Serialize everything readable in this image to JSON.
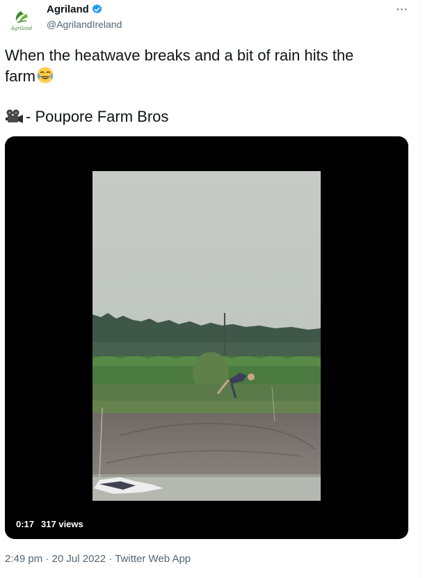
{
  "account": {
    "display_name": "Agriland",
    "handle": "@AgrilandIreland",
    "logo_text": "Agriland"
  },
  "tweet": {
    "text_line1": "When the heatwave breaks and a bit of rain hits the",
    "text_line2": "farm",
    "credit": "- Poupore Farm Bros"
  },
  "video": {
    "duration": "0:17",
    "views": "317 views"
  },
  "meta": {
    "time": "2:49 pm",
    "sep1": " · ",
    "date": "20 Jul 2022",
    "sep2": " · ",
    "source": "Twitter Web App"
  },
  "colors": {
    "verified": "#1d9bf0",
    "secondary_text": "#536471",
    "brand_green": "#3f8a2e"
  },
  "icons": {
    "more": "more-options-icon",
    "verified": "verified-badge-icon",
    "camera": "movie-camera-icon",
    "emoji": "face-with-tears-of-joy-icon"
  }
}
